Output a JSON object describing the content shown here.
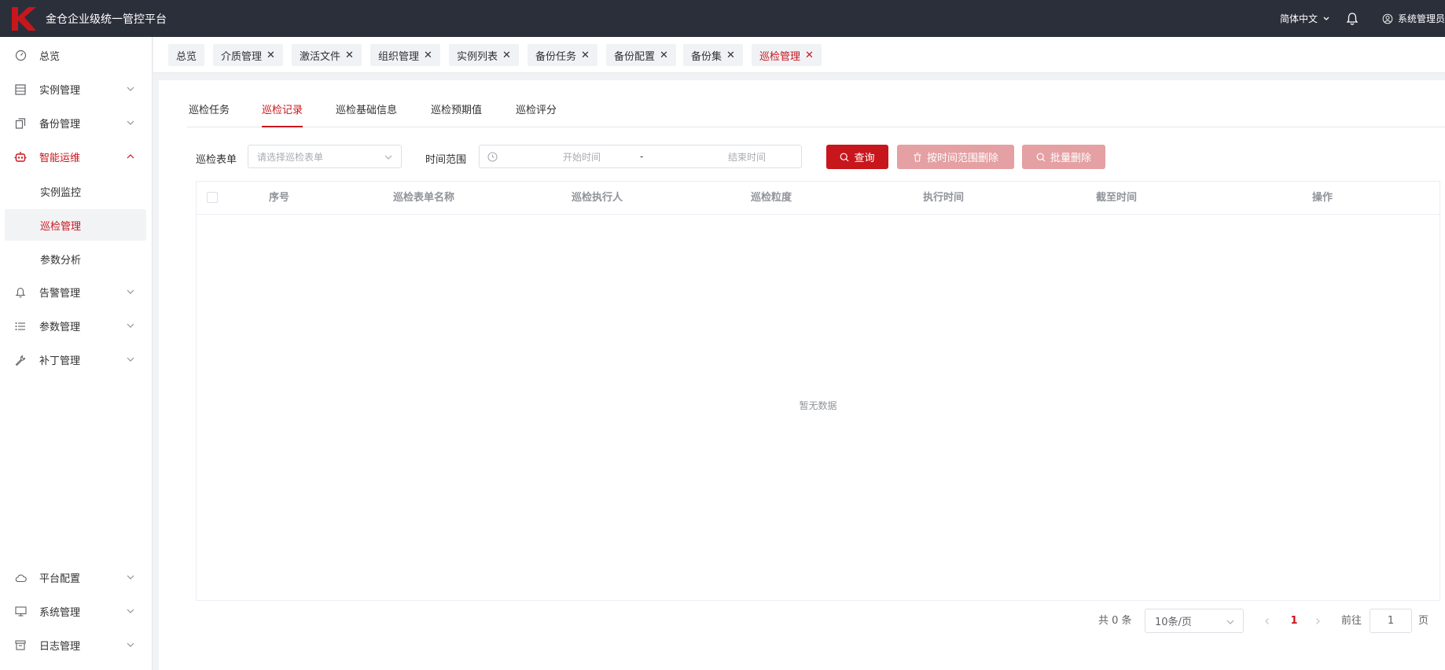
{
  "app": {
    "title": "金仓企业级统一管控平台",
    "language": "简体中文",
    "user": "系统管理员",
    "accent_color": "#c8161d",
    "header_bg": "#2b2f3a"
  },
  "sidebar": {
    "items": [
      {
        "label": "总览",
        "icon": "dashboard-icon"
      },
      {
        "label": "实例管理",
        "icon": "list-icon"
      },
      {
        "label": "备份管理",
        "icon": "copy-icon"
      },
      {
        "label": "智能运维",
        "icon": "robot-icon"
      },
      {
        "label": "告警管理",
        "icon": "bell-icon"
      },
      {
        "label": "参数管理",
        "icon": "menu-list-icon"
      },
      {
        "label": "补丁管理",
        "icon": "wrench-icon"
      },
      {
        "label": "平台配置",
        "icon": "cloud-icon"
      },
      {
        "label": "系统管理",
        "icon": "monitor-icon"
      },
      {
        "label": "日志管理",
        "icon": "archive-icon"
      }
    ],
    "submenu": [
      {
        "label": "实例监控"
      },
      {
        "label": "巡检管理"
      },
      {
        "label": "参数分析"
      }
    ]
  },
  "tags": [
    {
      "label": "总览"
    },
    {
      "label": "介质管理"
    },
    {
      "label": "激活文件"
    },
    {
      "label": "组织管理"
    },
    {
      "label": "实例列表"
    },
    {
      "label": "备份任务"
    },
    {
      "label": "备份配置"
    },
    {
      "label": "备份集"
    },
    {
      "label": "巡检管理"
    }
  ],
  "tabs": [
    {
      "label": "巡检任务"
    },
    {
      "label": "巡检记录"
    },
    {
      "label": "巡检基础信息"
    },
    {
      "label": "巡检预期值"
    },
    {
      "label": "巡检评分"
    }
  ],
  "filters": {
    "form_label": "巡检表单",
    "form_placeholder": "请选择巡检表单",
    "time_label": "时间范围",
    "start_placeholder": "开始时间",
    "separator": "-",
    "end_placeholder": "结束时间"
  },
  "buttons": {
    "query": "查询",
    "delete_by_range": "按时间范围删除",
    "batch_delete": "批量删除"
  },
  "table": {
    "columns": [
      "序号",
      "巡检表单名称",
      "巡检执行人",
      "巡检粒度",
      "执行时间",
      "截至时间",
      "操作"
    ],
    "empty_text": "暂无数据"
  },
  "pagination": {
    "total": "共 0 条",
    "page_size": "10条/页",
    "current_page": "1",
    "goto_label": "前往",
    "goto_value": "1",
    "page_suffix": "页"
  }
}
